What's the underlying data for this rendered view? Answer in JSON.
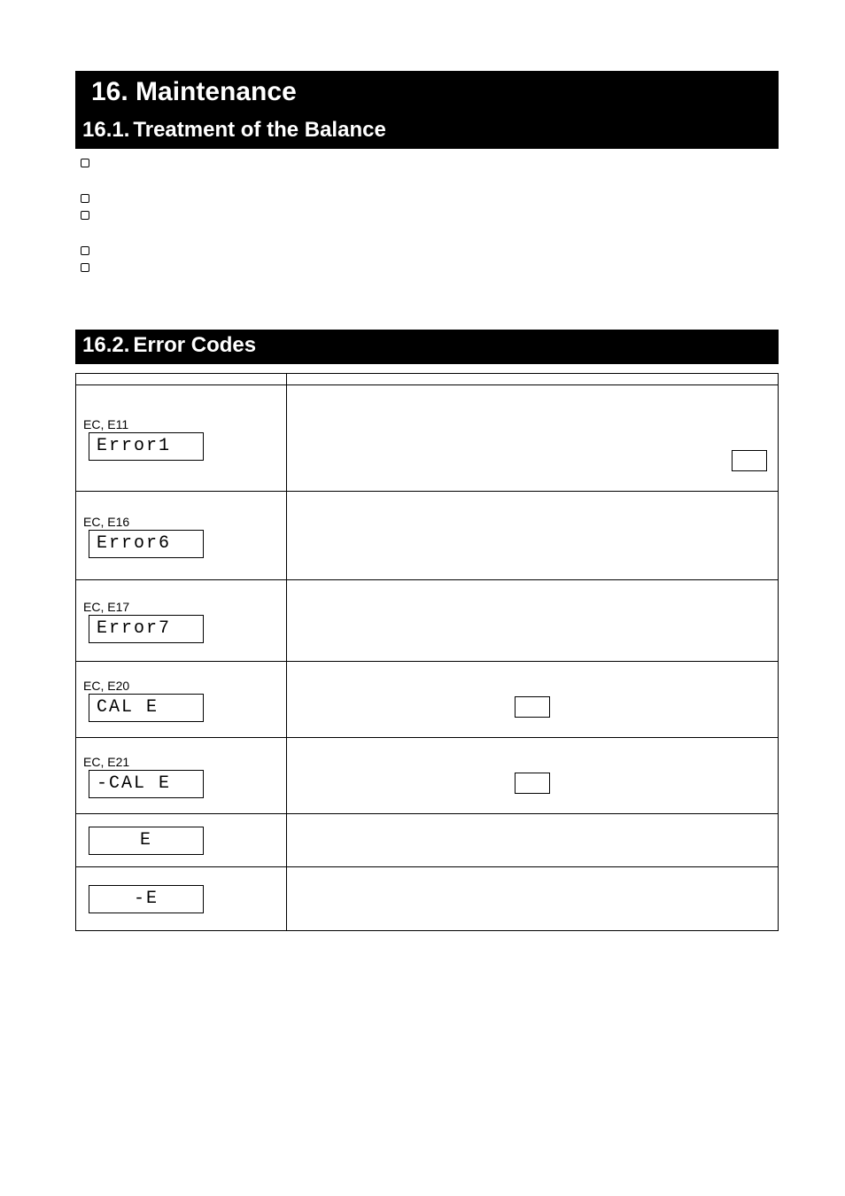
{
  "chapter": {
    "title": "16.  Maintenance"
  },
  "section161": {
    "num": "16.1.",
    "title": "Treatment of the Balance",
    "bullets": [
      "",
      "",
      "",
      "",
      ""
    ]
  },
  "section162": {
    "num": "16.2.",
    "title": "Error Codes",
    "th_display": "",
    "th_desc": "",
    "rows": [
      {
        "glyph": "Error1",
        "code": "EC, E11",
        "desc": ""
      },
      {
        "glyph": "Error6",
        "code": "EC, E16",
        "desc": ""
      },
      {
        "glyph": "Error7",
        "code": "EC, E17",
        "desc": ""
      },
      {
        "glyph": "CAL E",
        "code": "EC, E20",
        "desc": ""
      },
      {
        "glyph": "-CAL E",
        "code": "EC, E21",
        "desc": ""
      },
      {
        "glyph": "  E",
        "code": "",
        "desc": ""
      },
      {
        "glyph": "  -E",
        "code": "",
        "desc": ""
      }
    ]
  },
  "footer": ""
}
